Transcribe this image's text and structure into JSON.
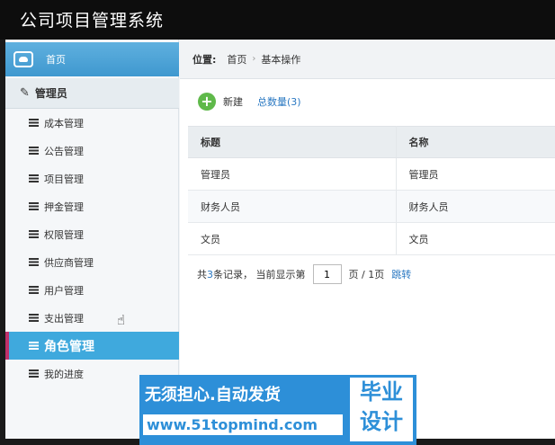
{
  "app": {
    "title": "公司项目管理系统"
  },
  "sidebar": {
    "home_label": "首页",
    "group_label": "管理员",
    "items": [
      {
        "label": "成本管理"
      },
      {
        "label": "公告管理"
      },
      {
        "label": "项目管理"
      },
      {
        "label": "押金管理"
      },
      {
        "label": "权限管理"
      },
      {
        "label": "供应商管理"
      },
      {
        "label": "用户管理"
      },
      {
        "label": "支出管理"
      },
      {
        "label": "角色管理",
        "active": true
      },
      {
        "label": "我的进度"
      }
    ]
  },
  "breadcrumb": {
    "prefix": "位置:",
    "home": "首页",
    "current": "基本操作",
    "separator": "›"
  },
  "toolbar": {
    "new_label": "新建",
    "total_label": "总数量(3)"
  },
  "table": {
    "columns": [
      "标题",
      "名称"
    ],
    "rows": [
      [
        "管理员",
        "管理员"
      ],
      [
        "财务人员",
        "财务人员"
      ],
      [
        "文员",
        "文员"
      ]
    ]
  },
  "pager": {
    "prefix": "共",
    "count": "3",
    "suffix": "条记录， 当前显示第",
    "current_page": "1",
    "page_info": "页 / 1页",
    "jump_label": "跳转"
  },
  "watermark": {
    "slogan": "无须担心.自动发货",
    "url": "www.51topmind.com",
    "badge": "毕业 设计"
  },
  "colors": {
    "accent": "#3fa9dd",
    "link": "#2a78c2",
    "add": "#5fb94a",
    "active_marker": "#c0306a"
  }
}
